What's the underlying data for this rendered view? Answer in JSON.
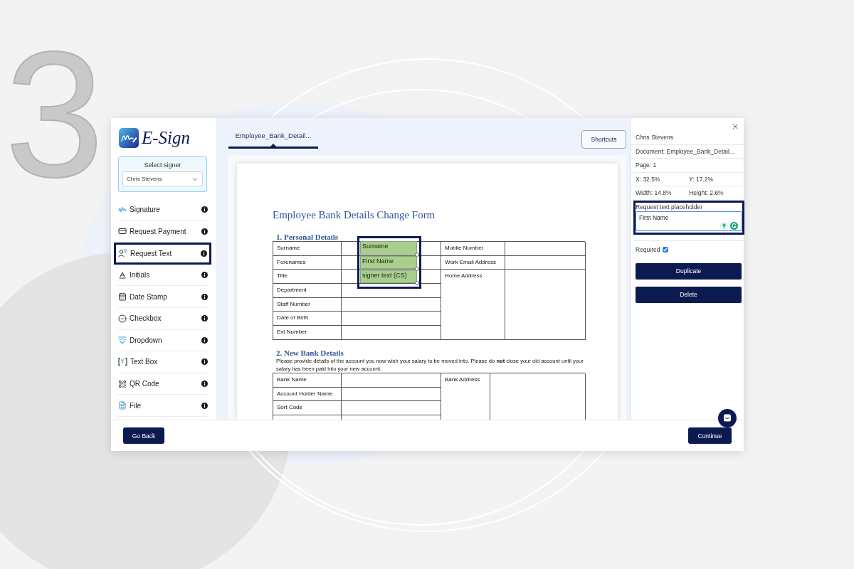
{
  "step_number": "3",
  "logo": {
    "text": "E-Sign"
  },
  "signer_select": {
    "label": "Select signer",
    "value": "Chris Stevens"
  },
  "tools": [
    {
      "kind": "signature",
      "label": "Signature",
      "selected": false
    },
    {
      "kind": "payment",
      "label": "Request Payment",
      "selected": false
    },
    {
      "kind": "text",
      "label": "Request Text",
      "selected": true
    },
    {
      "kind": "initials",
      "label": "Initials",
      "selected": false
    },
    {
      "kind": "date",
      "label": "Date Stamp",
      "selected": false
    },
    {
      "kind": "checkbox",
      "label": "Checkbox",
      "selected": false
    },
    {
      "kind": "dropdown",
      "label": "Dropdown",
      "selected": false
    },
    {
      "kind": "textbox",
      "label": "Text Box",
      "selected": false
    },
    {
      "kind": "qrcode",
      "label": "QR Code",
      "selected": false
    },
    {
      "kind": "file",
      "label": "File",
      "selected": false
    }
  ],
  "document_tab": {
    "label": "Employee_Bank_Detail...",
    "selected": true
  },
  "shortcuts_button": "Shortcuts",
  "document": {
    "title": "Employee Bank Details Change Form",
    "sections": [
      {
        "heading": "1. Personal Details",
        "left_labels": [
          "Surname",
          "Forenames",
          "Title",
          "Department",
          "Staff Number",
          "Date of Birth",
          "Ext Number"
        ],
        "right_labels": [
          "Mobile Number",
          "Work Email Address",
          "Home Address"
        ],
        "continues": false
      },
      {
        "heading": "2. New Bank Details",
        "note": "Please provide details of the account you now wish your salary to be moved into. Please do **not** close your old account until your salary has been paid into your new account.",
        "left_labels": [
          "Bank Name",
          "Account Holder Name",
          "Sort Code"
        ],
        "right_labels": [
          "Bank Address"
        ],
        "continues": true
      }
    ]
  },
  "placed_fields": {
    "selected": true,
    "fields": [
      {
        "text": "Surname"
      },
      {
        "text": "First Name"
      },
      {
        "text": "signer text (CS)"
      }
    ]
  },
  "properties": {
    "signer": "Chris Stevens",
    "document": "Document: Employee_Bank_Detail...",
    "page": "Page: 1",
    "x": "X: 32.5%",
    "y": "Y: 17.2%",
    "width": "Width: 14.8%",
    "height": "Height: 2.6%"
  },
  "placeholder_field": {
    "label": "Request text placeholder",
    "value": "First Name",
    "highlighted": true
  },
  "required": {
    "label": "Required",
    "checked": true
  },
  "panel_buttons": [
    "Duplicate",
    "Delete"
  ],
  "footer": {
    "back_button": "Go Back",
    "continue_button": "Continue"
  }
}
